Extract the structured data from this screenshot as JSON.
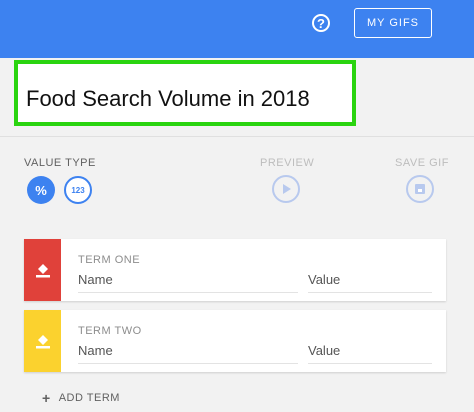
{
  "header": {
    "help_symbol": "?",
    "my_gifs_label": "MY GIFS",
    "bg_color": "#3d82f0"
  },
  "title": {
    "text": "Food Search Volume in 2018",
    "highlight_color": "#2ad40f"
  },
  "controls": {
    "value_type_label": "VALUE TYPE",
    "percent_symbol": "%",
    "number_symbol": "123",
    "preview_label": "PREVIEW",
    "save_gif_label": "SAVE GIF",
    "icons": [
      "play-icon",
      "save-icon"
    ]
  },
  "terms": [
    {
      "label": "TERM ONE",
      "name_placeholder": "Name",
      "value_placeholder": "Value",
      "color": "#e0413a",
      "icon": "paint-bucket-icon"
    },
    {
      "label": "TERM TWO",
      "name_placeholder": "Name",
      "value_placeholder": "Value",
      "color": "#fbd22e",
      "icon": "paint-bucket-icon"
    }
  ],
  "add_term": {
    "plus": "+",
    "label": "ADD TERM"
  }
}
